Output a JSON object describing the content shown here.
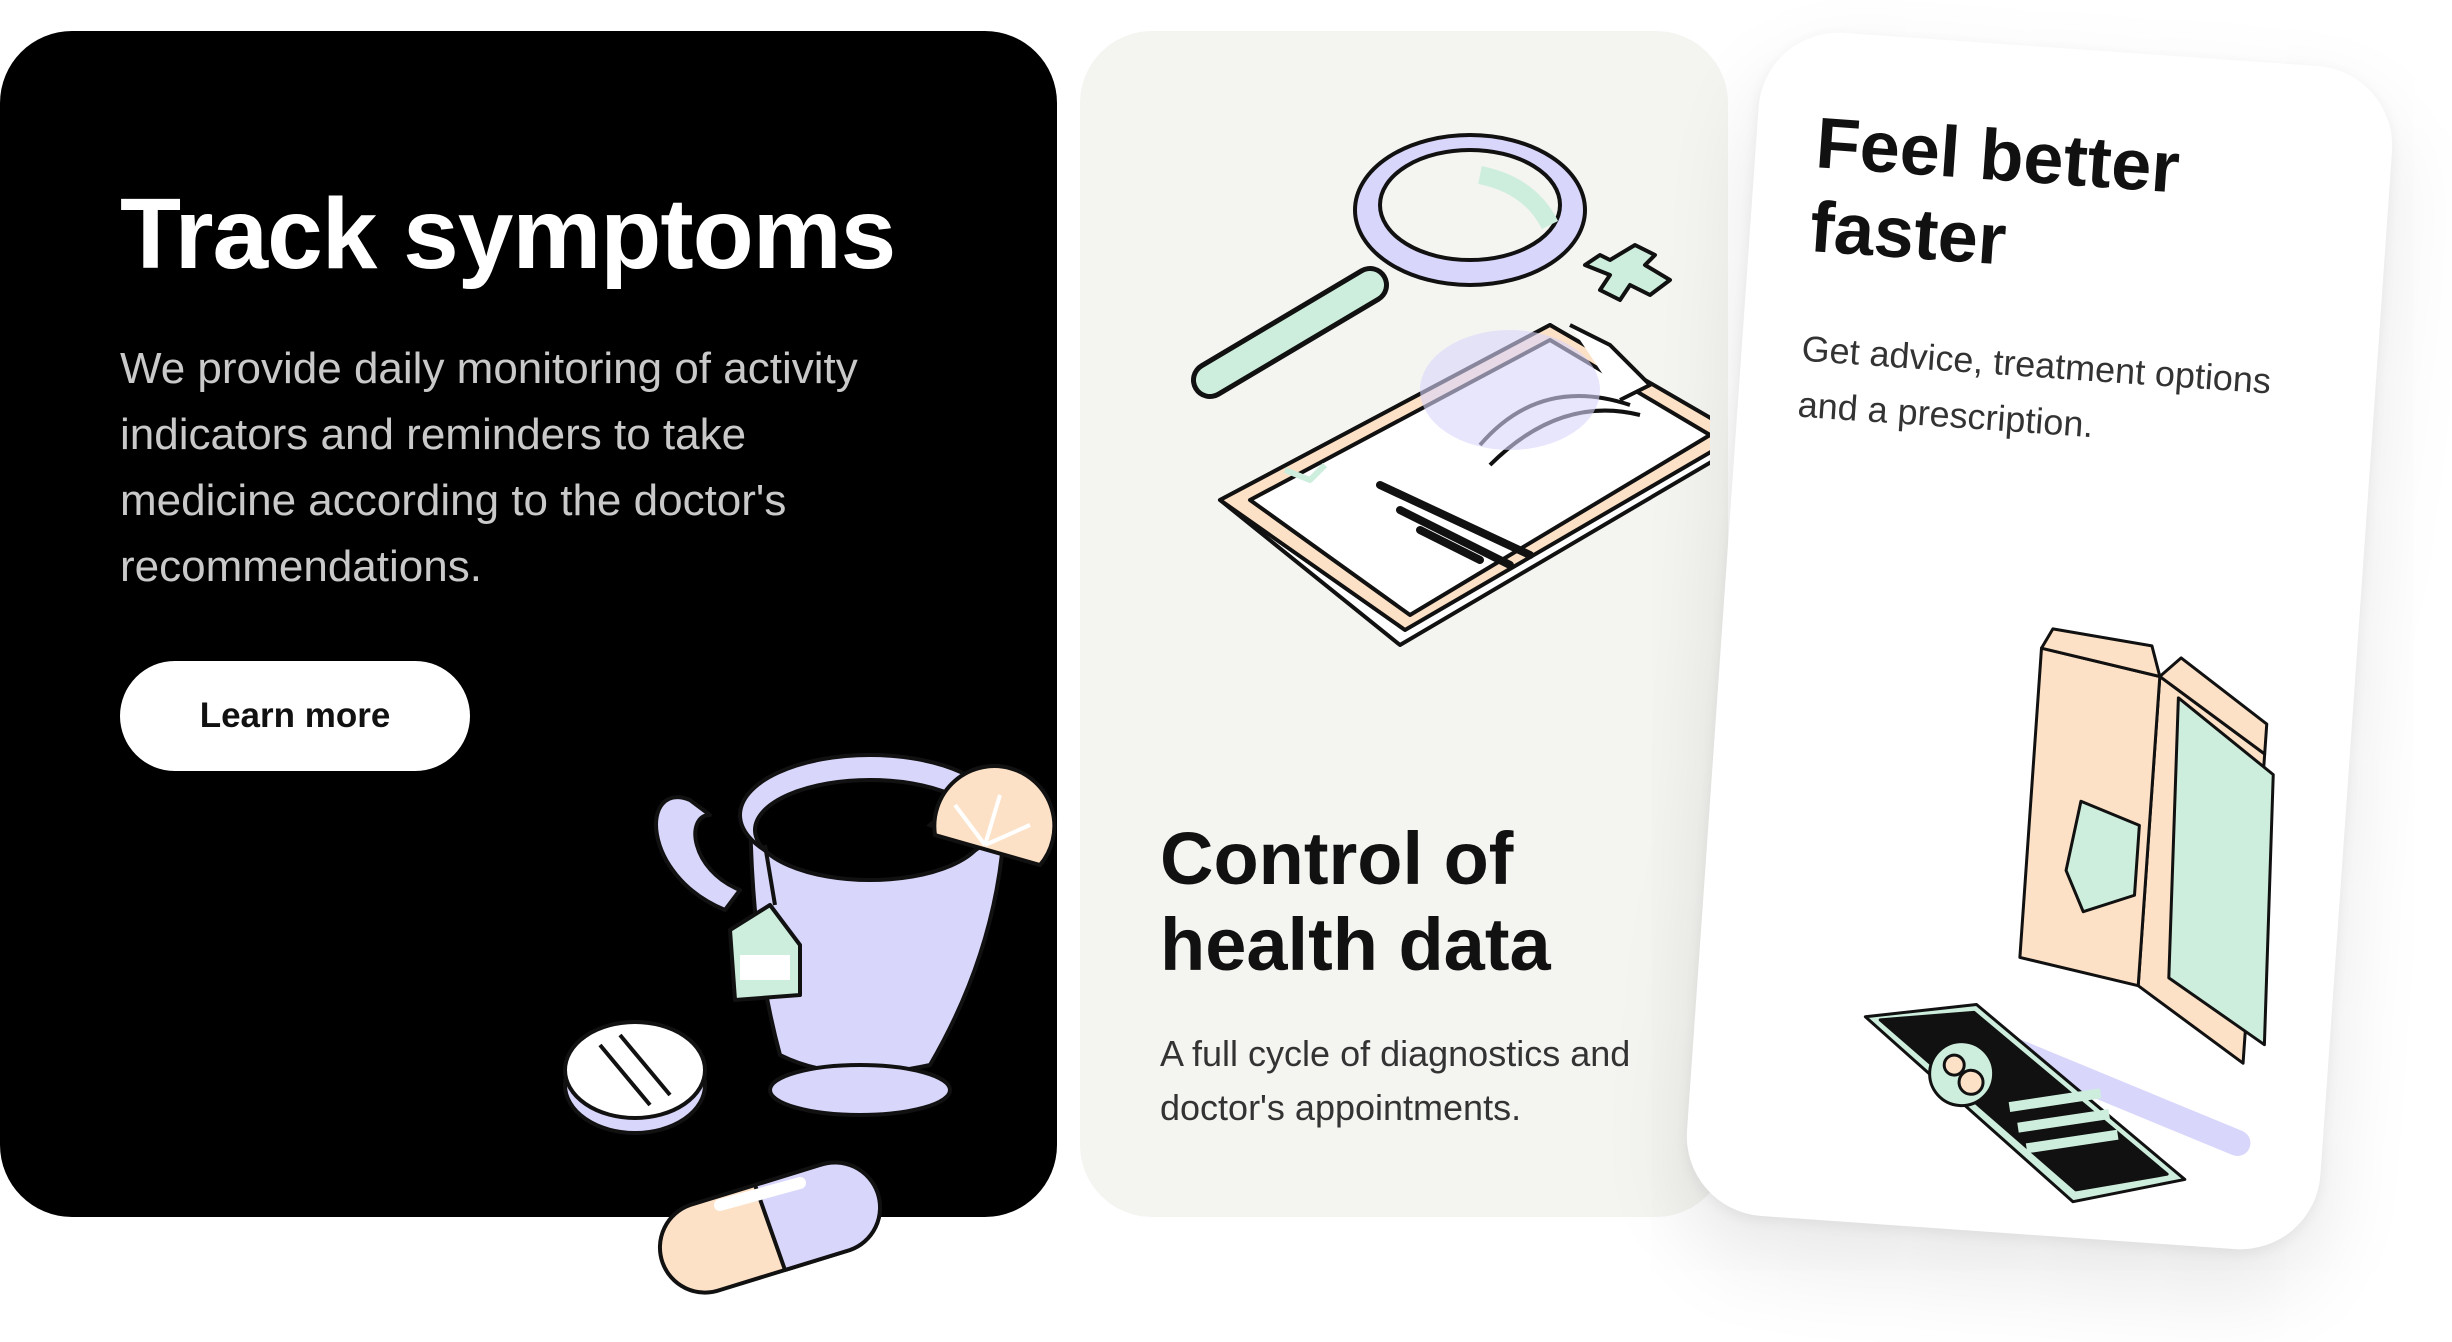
{
  "cards": {
    "track": {
      "title": "Track symptoms",
      "description": "We provide daily monitoring of activity indicators and reminders to take medicine according to the doctor's recommendations.",
      "button_label": "Learn more"
    },
    "health": {
      "title": "Control of health data",
      "description": "A full cycle of diagnostics and doctor's appointments."
    },
    "feel": {
      "title": "Feel better faster",
      "description": "Get advice, treatment options and a prescription."
    }
  },
  "colors": {
    "black": "#000000",
    "lavender": "#d8d6fb",
    "mint": "#cdeedd",
    "peach": "#fde1c6",
    "card_grey": "#f4f4f1"
  },
  "icons": [
    "tea-cup-icon",
    "lemon-slice-icon",
    "tea-bag-icon",
    "pill-icon",
    "capsule-icon",
    "magnifier-icon",
    "cross-icon",
    "clipboard-icon",
    "folder-icon",
    "smartphone-icon"
  ]
}
